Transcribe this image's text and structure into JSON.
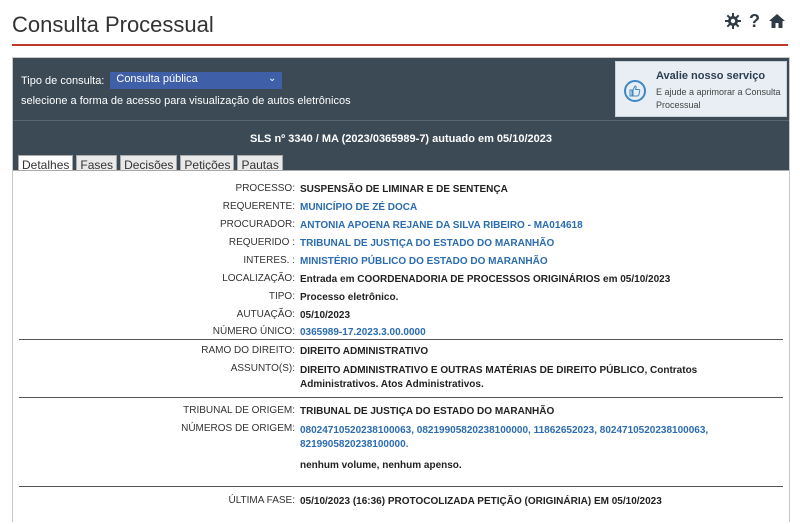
{
  "header": {
    "title": "Consulta Processual",
    "icons": [
      "gear-icon",
      "question-icon",
      "home-icon"
    ]
  },
  "toolbar": {
    "tipo_label": "Tipo de consulta:",
    "tipo_selected": "Consulta pública",
    "hint": "selecione a forma de acesso para visualização de autos eletrônicos",
    "avalie_title": "Avalie nosso serviço",
    "avalie_sub": "E ajude a aprimorar a Consulta Processual"
  },
  "process": {
    "title": "SLS nº 3340 / MA (2023/0365989-7) autuado em 05/10/2023"
  },
  "tabs": [
    "Detalhes",
    "Fases",
    "Decisões",
    "Petições",
    "Pautas"
  ],
  "details": {
    "processo_label": "PROCESSO:",
    "processo": "SUSPENSÃO DE LIMINAR E DE SENTENÇA",
    "requerente_label": "REQUERENTE:",
    "requerente": "MUNICÍPIO DE ZÉ DOCA",
    "procurador_label": "PROCURADOR:",
    "procurador": "ANTONIA APOENA REJANE DA SILVA RIBEIRO - MA014618",
    "requerido_label": "REQUERIDO :",
    "requerido": "TRIBUNAL DE JUSTIÇA DO ESTADO DO MARANHÃO",
    "interes_label": "INTERES. :",
    "interes": "MINISTÉRIO PÚBLICO DO ESTADO DO MARANHÃO",
    "localizacao_label": "LOCALIZAÇÃO:",
    "localizacao": "Entrada em COORDENADORIA DE PROCESSOS ORIGINÁRIOS em 05/10/2023",
    "tipo_label": "TIPO:",
    "tipo": "Processo eletrônico.",
    "autuacao_label": "AUTUAÇÃO:",
    "autuacao": "05/10/2023",
    "numero_unico_label": "NÚMERO ÚNICO:",
    "numero_unico": "0365989-17.2023.3.00.0000",
    "ramo_label": "RAMO DO DIREITO:",
    "ramo": "DIREITO ADMINISTRATIVO",
    "assunto_label": "ASSUNTO(S):",
    "assunto": "DIREITO ADMINISTRATIVO E OUTRAS MATÉRIAS DE DIREITO PÚBLICO, Contratos Administrativos. Atos Administrativos.",
    "tribunal_label": "TRIBUNAL DE ORIGEM:",
    "tribunal": "TRIBUNAL DE JUSTIÇA DO ESTADO DO MARANHÃO",
    "numeros_label": "NÚMEROS DE ORIGEM:",
    "numeros": "08024710520238100063, 08219905820238100000, 11862652023, 8024710520238100063, 8219905820238100000.",
    "volumes": "nenhum volume, nenhum apenso.",
    "ultima_label": "ÚLTIMA FASE:",
    "ultima": "05/10/2023 (16:36) PROTOCOLIZADA PETIÇÃO (ORIGINÁRIA) EM 05/10/2023"
  },
  "colors": {
    "accent_red": "#c0392b",
    "header_bg": "#3b4a55",
    "link_blue": "#2b6cb0",
    "select_blue": "#3f5fa8"
  }
}
